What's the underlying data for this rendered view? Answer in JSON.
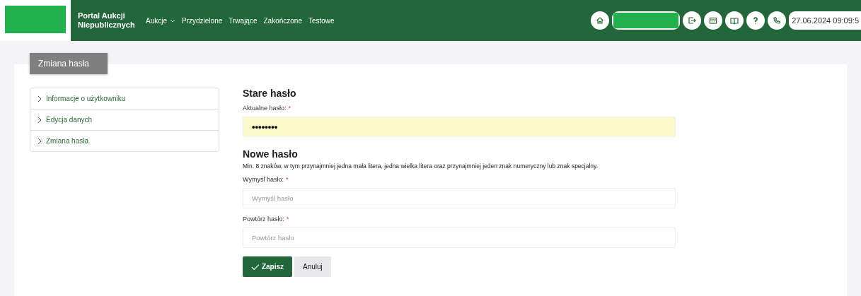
{
  "header": {
    "title": "Portal Aukcji Niepublicznych",
    "nav": [
      {
        "label": "Aukcje",
        "dropdown": true
      },
      {
        "label": "Przydzielone",
        "dropdown": false
      },
      {
        "label": "Trwające",
        "dropdown": false
      },
      {
        "label": "Zakończone",
        "dropdown": false
      },
      {
        "label": "Testowe",
        "dropdown": false
      }
    ],
    "tools": [
      {
        "kind": "home"
      },
      {
        "kind": "redacted"
      },
      {
        "kind": "exit"
      },
      {
        "kind": "calendar"
      },
      {
        "kind": "book"
      },
      {
        "kind": "help"
      },
      {
        "kind": "phone"
      }
    ],
    "datetime": "27.06.2024 09:09:5"
  },
  "page_tab": "Zmiana hasła",
  "sidebar": {
    "items": [
      {
        "label": "Informacje o użytkowniku"
      },
      {
        "label": "Edycja danych"
      },
      {
        "label": "Zmiana hasła"
      }
    ]
  },
  "form": {
    "sections": [
      {
        "title": "Stare hasło",
        "fields": [
          {
            "label": "Aktualne hasło:",
            "required_mark": "*",
            "value": "••••••••",
            "autofilled": true
          }
        ]
      },
      {
        "title": "Nowe hasło",
        "hint": "Min. 8 znaków, w tym przynajmniej jedna mała litera, jedna wielka litera oraz przynajmniej jeden znak numeryczny lub znak specjalny.",
        "fields": [
          {
            "label": "Wymyśl hasło:",
            "required_mark": "*",
            "placeholder": "Wymyśl hasło",
            "autofilled": false
          },
          {
            "label": "Powtórz hasło:",
            "required_mark": "*",
            "placeholder": "Powtórz hasło",
            "autofilled": false
          }
        ]
      }
    ],
    "buttons": [
      {
        "label": "Zapisz",
        "kind": "primary"
      },
      {
        "label": "Anuluj",
        "kind": "secondary"
      }
    ]
  }
}
